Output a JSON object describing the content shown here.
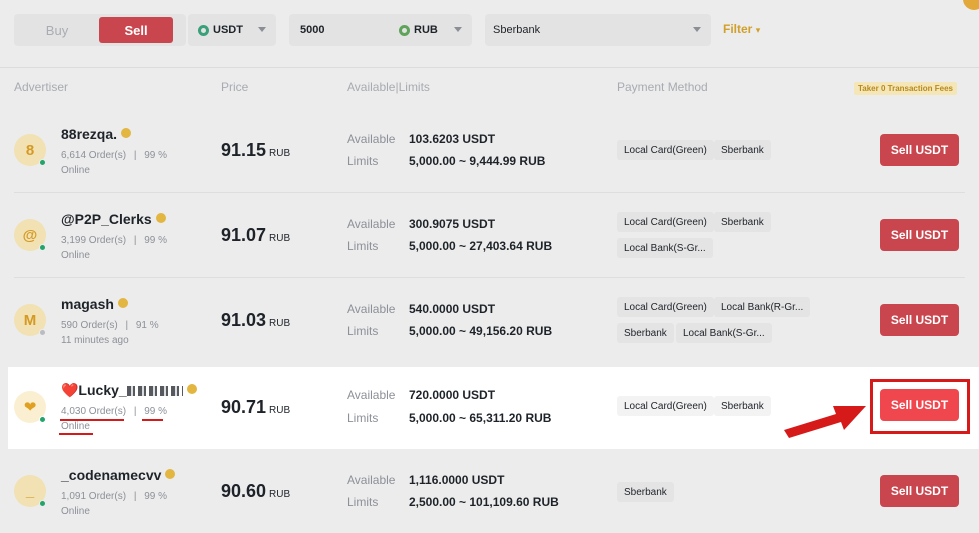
{
  "filters": {
    "trade_type_buy": "Buy",
    "trade_type_sell": "Sell",
    "asset": "USDT",
    "amount": "5000",
    "fiat": "RUB",
    "payment": "Sberbank",
    "filter_label": "Filter",
    "filter_icon": "▾"
  },
  "columns": {
    "advertiser": "Advertiser",
    "price": "Price",
    "available_limits": "Available|Limits",
    "payment_method": "Payment Method",
    "taker_fees": "Taker 0 Transaction Fees"
  },
  "labels": {
    "available": "Available",
    "limits": "Limits"
  },
  "rows": [
    {
      "initial": "8",
      "name": "88rezqa.",
      "orders": "6,614 Order(s)",
      "sep": "|",
      "completion": "99 %",
      "status": "Online",
      "price": "91.15",
      "currency": "RUB",
      "available": "103.6203 USDT",
      "limits": "5,000.00 ~ 9,444.99 RUB",
      "methods": [
        "Local Card(Green)",
        "Sberbank"
      ],
      "button": "Sell USDT"
    },
    {
      "initial": "@",
      "name": "@P2P_Clerks",
      "orders": "3,199 Order(s)",
      "sep": "|",
      "completion": "99 %",
      "status": "Online",
      "price": "91.07",
      "currency": "RUB",
      "available": "300.9075 USDT",
      "limits": "5,000.00 ~ 27,403.64 RUB",
      "methods": [
        "Local Card(Green)",
        "Sberbank",
        "Local Bank(S-Gr..."
      ],
      "button": "Sell USDT"
    },
    {
      "initial": "M",
      "name": "magash",
      "orders": "590 Order(s)",
      "sep": "|",
      "completion": "91 %",
      "status": "11 minutes ago",
      "price": "91.03",
      "currency": "RUB",
      "available": "540.0000 USDT",
      "limits": "5,000.00 ~ 49,156.20 RUB",
      "methods": [
        "Local Card(Green)",
        "Local Bank(R-Gr...",
        "Sberbank",
        "Local Bank(S-Gr..."
      ],
      "button": "Sell USDT"
    },
    {
      "initial": "❤",
      "name": "❤️Lucky_",
      "orders": "4,030 Order(s)",
      "sep": "|",
      "completion": "99 %",
      "status": "Online",
      "price": "90.71",
      "currency": "RUB",
      "available": "720.0000 USDT",
      "limits": "5,000.00 ~ 65,311.20 RUB",
      "methods": [
        "Local Card(Green)",
        "Sberbank"
      ],
      "button": "Sell USDT"
    },
    {
      "initial": "_",
      "name": "_codenamecvv",
      "orders": "1,091 Order(s)",
      "sep": "|",
      "completion": "99 %",
      "status": "Online",
      "price": "90.60",
      "currency": "RUB",
      "available": "1,116.0000 USDT",
      "limits": "2,500.00 ~ 101,109.60 RUB",
      "methods": [
        "Sberbank"
      ],
      "button": "Sell USDT"
    }
  ],
  "colors": {
    "sell_button": "#f0474f",
    "annotation_red": "#d61a1a",
    "online_green": "#22a46a",
    "accent_gold": "#d1a02a"
  }
}
